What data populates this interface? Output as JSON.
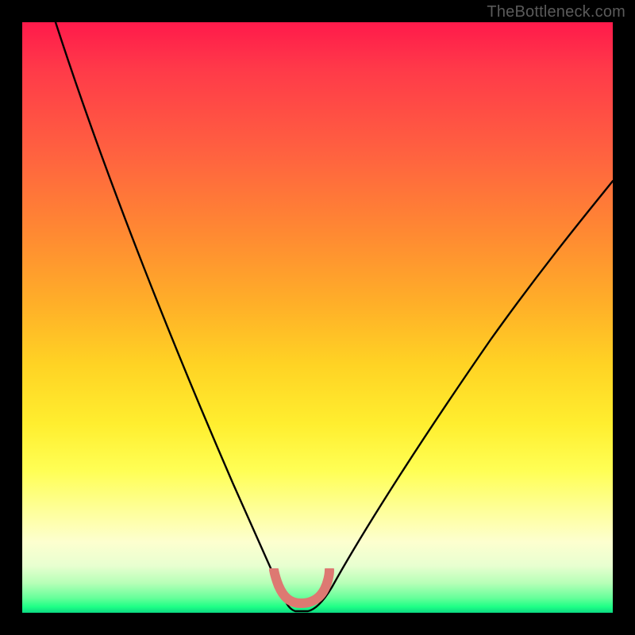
{
  "watermark": "TheBottleneck.com",
  "chart_data": {
    "type": "line",
    "title": "",
    "xlabel": "",
    "ylabel": "",
    "xlim": [
      0,
      100
    ],
    "ylim": [
      0,
      100
    ],
    "grid": false,
    "legend": false,
    "series": [
      {
        "name": "bottleneck-curve",
        "x": [
          0,
          5,
          10,
          15,
          20,
          25,
          30,
          35,
          38,
          40,
          42,
          44,
          46,
          48,
          50,
          55,
          60,
          65,
          70,
          75,
          80,
          85,
          90,
          95,
          100
        ],
        "y": [
          100,
          90,
          80,
          70,
          60,
          50,
          40,
          28,
          18,
          10,
          4,
          1,
          0,
          0,
          2,
          8,
          16,
          24,
          32,
          40,
          47,
          53,
          58,
          62,
          64
        ]
      }
    ],
    "annotations": [
      {
        "name": "minimum-marker",
        "type": "U-shape",
        "color": "#dd7972",
        "x_center": 46,
        "y_center": 2,
        "width": 10,
        "height": 6
      }
    ],
    "background_gradient_stops": [
      {
        "pos": 0.0,
        "color": "#ff1a4b"
      },
      {
        "pos": 0.22,
        "color": "#ff6140"
      },
      {
        "pos": 0.48,
        "color": "#ffb028"
      },
      {
        "pos": 0.68,
        "color": "#ffee2f"
      },
      {
        "pos": 0.88,
        "color": "#fdffcf"
      },
      {
        "pos": 0.97,
        "color": "#66ff9a"
      },
      {
        "pos": 1.0,
        "color": "#0cd982"
      }
    ]
  }
}
